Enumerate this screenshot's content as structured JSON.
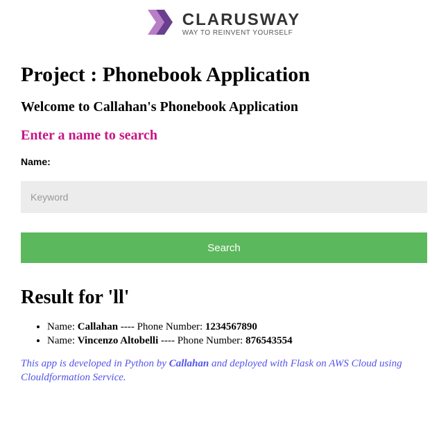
{
  "logo": {
    "name": "CLARUSWAY",
    "tagline": "WAY TO REINVENT YOURSELF"
  },
  "heading": "Project : Phonebook Application",
  "welcome": "Welcome to Callahan's Phonebook Application",
  "prompt": "Enter a name to search",
  "form": {
    "label": "Name:",
    "placeholder": "Keyword",
    "value": "",
    "button": "Search"
  },
  "results": {
    "heading": "Result for 'll'",
    "item_label_name": "Name: ",
    "separator": " ---- ",
    "item_label_phone": "Phone Number: ",
    "items": [
      {
        "name": "Callahan",
        "phone": "1234567890"
      },
      {
        "name": "Vincenzo Altobelli",
        "phone": "876543554"
      }
    ]
  },
  "footer": {
    "pre": "This app is developed in Python by ",
    "author": "Callahan",
    "post": " and deployed with Flask on AWS Cloud using Clouldformation Service."
  }
}
